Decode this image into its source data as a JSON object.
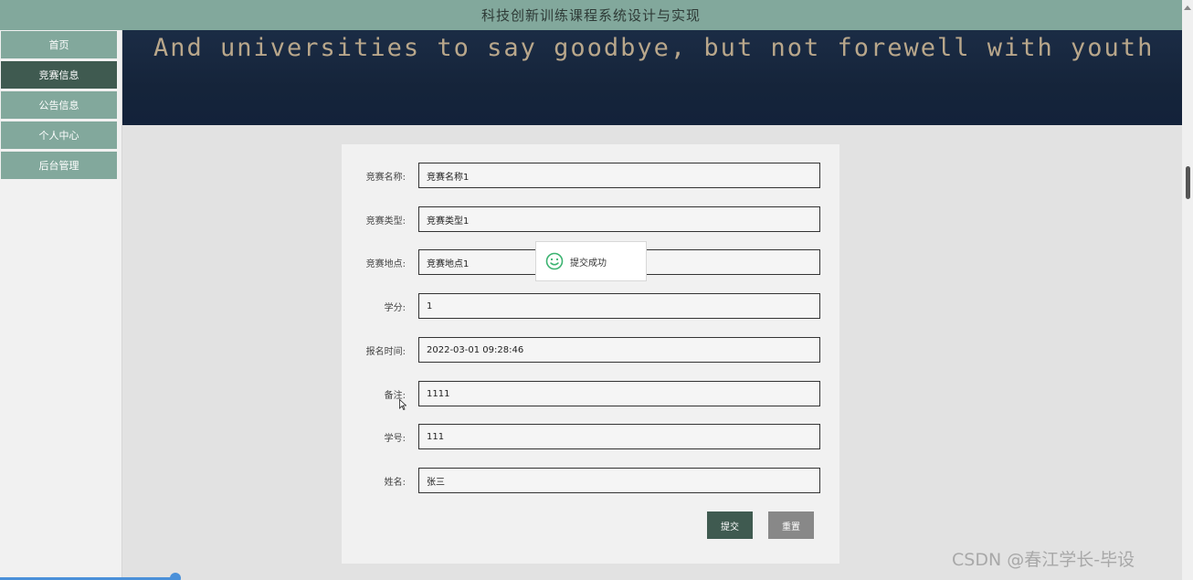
{
  "header": {
    "title": "科技创新训练课程系统设计与实现"
  },
  "sidebar": {
    "items": [
      {
        "label": "首页"
      },
      {
        "label": "竞赛信息"
      },
      {
        "label": "公告信息"
      },
      {
        "label": "个人中心"
      },
      {
        "label": "后台管理"
      }
    ],
    "active_index": 1
  },
  "banner": {
    "text": "And universities to say goodbye, but not forewell with youth"
  },
  "form": {
    "fields": [
      {
        "label": "竞赛名称:",
        "value": "竞赛名称1"
      },
      {
        "label": "竞赛类型:",
        "value": "竞赛类型1"
      },
      {
        "label": "竞赛地点:",
        "value": "竞赛地点1"
      },
      {
        "label": "学分:",
        "value": "1"
      },
      {
        "label": "报名时间:",
        "value": "2022-03-01 09:28:46"
      },
      {
        "label": "备注:",
        "value": "1111"
      },
      {
        "label": "学号:",
        "value": "111"
      },
      {
        "label": "姓名:",
        "value": "张三"
      }
    ],
    "submit_label": "提交",
    "reset_label": "重置"
  },
  "toast": {
    "message": "提交成功",
    "icon": "smile-icon",
    "color": "#3cb371"
  },
  "watermark": {
    "text": "CSDN @春江学长-毕设"
  },
  "colors": {
    "accent": "#82a89c",
    "active": "#3f5a50",
    "banner": "#15243a"
  }
}
